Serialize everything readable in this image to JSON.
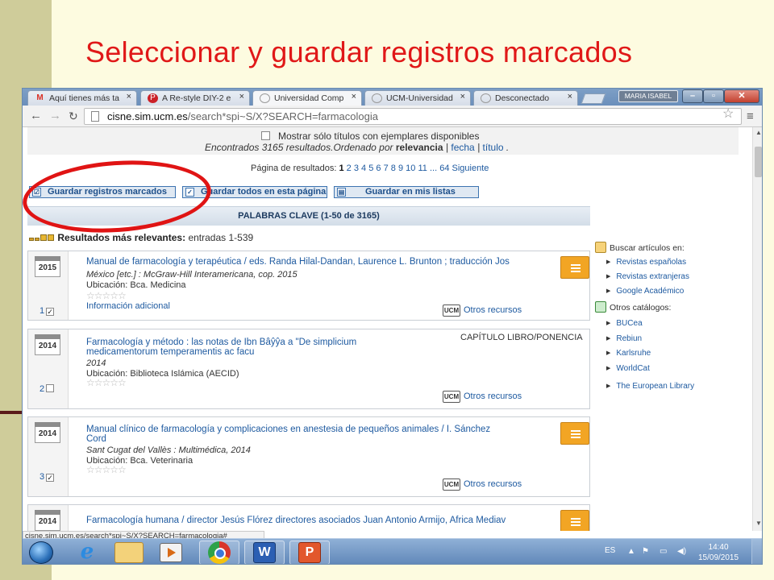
{
  "slide": {
    "title": "Seleccionar y guardar registros marcados"
  },
  "browser": {
    "tabs": [
      {
        "label": "Aquí tienes más ta",
        "icon": "gmail-icon",
        "active": false
      },
      {
        "label": "A Re-style DIY-2 e",
        "icon": "pinterest-icon",
        "active": false
      },
      {
        "label": "Universidad Comp",
        "icon": "ucm-icon",
        "active": true
      },
      {
        "label": "UCM-Universidad",
        "icon": "ucm-icon",
        "active": false
      },
      {
        "label": "Desconectado",
        "icon": "ucm-icon",
        "active": false
      }
    ],
    "tab_close": "×",
    "user_chip": "MARIA ISABEL",
    "url_host": "cisne.sim.ucm.es",
    "url_path": "/search*spi~S/X?SEARCH=farmacologia",
    "status_url": "cisne.sim.ucm.es/search*spi~S/X?SEARCH=farmacologia#"
  },
  "results": {
    "only_titles_option": "Mostrar sólo títulos con ejemplares disponibles",
    "found_prefix": "Encontrados 3165 resultados.Ordenado por",
    "sort_relevancia": "relevancia",
    "sort_sep1": "|",
    "sort_fecha": "fecha",
    "sort_sep2": "|",
    "sort_titulo": "título",
    "found_suffix": ".",
    "pager_label": "Página de resultados:",
    "pager_current": "1",
    "pager_pages": [
      "2",
      "3",
      "4",
      "5",
      "6",
      "7",
      "8",
      "9",
      "10",
      "11"
    ],
    "pager_ellipsis": "...",
    "pager_last": "64",
    "pager_next": "Siguiente",
    "buttons": {
      "save_marked": "Guardar registros marcados",
      "save_all": "Guardar todos en esta página",
      "save_lists": "Guardar en mis listas"
    },
    "keyword_header": "PALABRAS CLAVE (1-50 de 3165)",
    "relevance_label": "Resultados más relevantes:",
    "relevance_value": "entradas 1-539"
  },
  "records": [
    {
      "year": "2015",
      "number": "1",
      "checked": true,
      "title1": "Manual de farmacología y terapéutica / eds. Randa Hilal-Dandan, Laurence L. Brunton ; traducción Jos",
      "title2": "",
      "pub": "México [etc.] : McGraw-Hill Interamericana, cop. 2015",
      "location": "Ubicación: Bca. Medicina",
      "stars": "☆☆☆☆☆",
      "extra": "Información adicional",
      "type": "",
      "otros": "Otros recursos"
    },
    {
      "year": "2014",
      "number": "2",
      "checked": false,
      "title1": "Farmacología y método : las notas de Ibn Bâŷŷa a \"De simplicium",
      "title2": "medicamentorum temperamentis ac facu",
      "pub": "2014",
      "location": "Ubicación: Biblioteca Islámica (AECID)",
      "stars": "☆☆☆☆☆",
      "extra": "",
      "type": "CAPÍTULO LIBRO/PONENCIA",
      "otros": "Otros recursos"
    },
    {
      "year": "2014",
      "number": "3",
      "checked": true,
      "title1": "Manual clínico de farmacología y complicaciones en anestesia de pequeños animales / I. Sánchez",
      "title2": "Cord",
      "pub": "Sant Cugat del Vallès : Multimédica, 2014",
      "location": "Ubicación: Bca. Veterinaria",
      "stars": "☆☆☆☆☆",
      "extra": "",
      "type": "",
      "otros": "Otros recursos"
    },
    {
      "year": "2014",
      "number": "",
      "checked": false,
      "title1": "Farmacología humana / director Jesús Flórez directores asociados Juan Antonio Armijo, Africa Mediav",
      "title2": "",
      "pub": "",
      "location": "",
      "stars": "",
      "extra": "",
      "type": "",
      "otros": ""
    }
  ],
  "ucm_badge": "UCM",
  "sidebar": {
    "articles_heading": "Buscar artículos en:",
    "articles": [
      "Revistas españolas",
      "Revistas extranjeras",
      "Google Académico"
    ],
    "catalogs_heading": "Otros catálogos:",
    "catalogs": [
      "BUCea",
      "Rebiun",
      "Karlsruhe",
      "WorldCat",
      "The European Library"
    ]
  },
  "taskbar": {
    "language": "ES",
    "time": "14:40",
    "date": "15/09/2015",
    "word_letter": "W",
    "ppt_letter": "P",
    "ie_letter": "e"
  },
  "colors": {
    "slide_bg": "#fdfbe0",
    "title_red": "#e01818",
    "link_blue": "#1e5aa0",
    "annotation_red": "#e01414"
  }
}
